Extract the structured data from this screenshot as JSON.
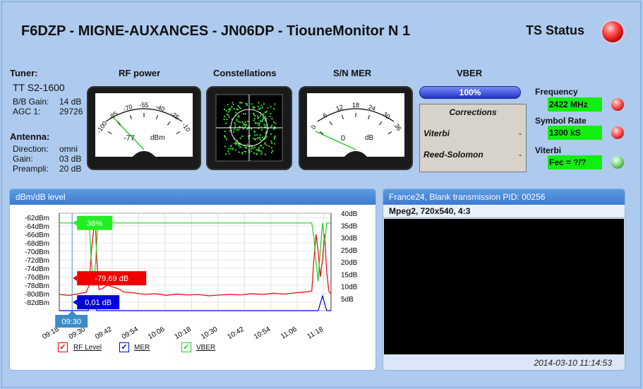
{
  "header": {
    "title": "F6DZP - MIGNE-AUXANCES - JN06DP - TiouneMonitor N 1",
    "ts_status": "TS Status"
  },
  "tuner": {
    "label": "Tuner:",
    "model": "TT S2-1600",
    "bb_gain_label": "B/B Gain:",
    "bb_gain": "14 dB",
    "agc_label": "AGC 1:",
    "agc": "29726"
  },
  "antenna": {
    "label": "Antenna:",
    "direction_label": "Direction:",
    "direction": "omni",
    "gain_label": "Gain:",
    "gain": "03 dB",
    "preampli_label": "Preampli:",
    "preampli": "20 dB"
  },
  "sections": {
    "rf_power": "RF power",
    "constellations": "Constellations",
    "sn_mer": "S/N MER",
    "vber": "VBER"
  },
  "rf_meter": {
    "ticks": [
      "-100",
      "-85",
      "-70",
      "-55",
      "-40",
      "-25",
      "-10"
    ],
    "value": "-77",
    "unit": "dBm",
    "needle_fraction": 0.3
  },
  "mer_meter": {
    "ticks": [
      "0",
      "6",
      "12",
      "18",
      "24",
      "30",
      "36"
    ],
    "value": "0",
    "unit": "dB",
    "needle_fraction": 0.0
  },
  "vber_bar": {
    "label": "100%",
    "fraction": 1.0
  },
  "corrections": {
    "title": "Corrections",
    "viterbi_label": "Viterbi",
    "viterbi": "-",
    "rs_label": "Reed-Solomon",
    "rs": "-"
  },
  "status": {
    "frequency_label": "Frequency",
    "frequency": "2422 MHz",
    "symbol_rate_label": "Symbol Rate",
    "symbol_rate": "1300 kS",
    "viterbi_label": "Viterbi",
    "viterbi": "Fec = ?/?"
  },
  "level_panel": {
    "title": "dBm/dB level"
  },
  "video_panel": {
    "title": "France24, Blank transmission PID: 00256",
    "format": "Mpeg2, 720x540, 4:3",
    "timestamp": "2014-03-10 11:14:53"
  },
  "chart_data": {
    "type": "line",
    "left_axis_ticks": [
      "-62dBm",
      "-64dBm",
      "-66dBm",
      "-68dBm",
      "-70dBm",
      "-72dBm",
      "-74dBm",
      "-76dBm",
      "-78dBm",
      "-80dBm",
      "-82dBm"
    ],
    "right_axis_ticks": [
      "40dB",
      "35dB",
      "30dB",
      "25dB",
      "20dB",
      "15dB",
      "10dB",
      "5dB"
    ],
    "x_ticks": [
      "09:18",
      "09:30",
      "09:42",
      "09:54",
      "10:06",
      "10:18",
      "10:30",
      "10:42",
      "10:54",
      "11:06",
      "11:18"
    ],
    "ylim_left": [
      -84,
      -61
    ],
    "ylim_right": [
      0,
      40
    ],
    "series": [
      {
        "name": "RF Level",
        "color": "#ee0000",
        "y_axis": "left",
        "points": [
          [
            0,
            -80.2
          ],
          [
            10,
            -80.4
          ],
          [
            20,
            -79.9
          ],
          [
            25,
            -79.7
          ],
          [
            28,
            -78
          ],
          [
            30,
            -70
          ],
          [
            32,
            -65
          ],
          [
            34,
            -64.5
          ],
          [
            35,
            -72
          ],
          [
            37,
            -79
          ],
          [
            40,
            -78.8
          ],
          [
            45,
            -78
          ],
          [
            50,
            -78.4
          ],
          [
            55,
            -78.8
          ],
          [
            60,
            -79.6
          ],
          [
            70,
            -79.8
          ],
          [
            80,
            -80.2
          ],
          [
            90,
            -80
          ],
          [
            100,
            -80.4
          ],
          [
            110,
            -80.1
          ],
          [
            120,
            -80.3
          ],
          [
            130,
            -80.2
          ],
          [
            140,
            -80.5
          ],
          [
            150,
            -80.3
          ],
          [
            160,
            -80.2
          ],
          [
            170,
            -80.3
          ],
          [
            180,
            -80
          ],
          [
            190,
            -80.2
          ],
          [
            200,
            -79.9
          ],
          [
            210,
            -80.1
          ],
          [
            220,
            -79.8
          ],
          [
            230,
            -79.6
          ],
          [
            236,
            -79.4
          ],
          [
            238,
            -72
          ],
          [
            240,
            -66
          ],
          [
            242,
            -70
          ],
          [
            244,
            -76
          ],
          [
            246,
            -72
          ],
          [
            248,
            -66
          ],
          [
            250,
            -75
          ],
          [
            252,
            -79.5
          ],
          [
            254,
            -80
          ]
        ]
      },
      {
        "name": "MER",
        "color": "#0000dd",
        "y_axis": "right",
        "points": [
          [
            0,
            0
          ],
          [
            25,
            0
          ],
          [
            27,
            0
          ],
          [
            29,
            3
          ],
          [
            31,
            6
          ],
          [
            33,
            3
          ],
          [
            35,
            0
          ],
          [
            242,
            0
          ],
          [
            244,
            3
          ],
          [
            246,
            6
          ],
          [
            248,
            3
          ],
          [
            250,
            0
          ],
          [
            254,
            0
          ]
        ]
      },
      {
        "name": "VBER",
        "color": "#22cc22",
        "y_axis": "right",
        "points": [
          [
            0,
            36
          ],
          [
            28,
            36
          ],
          [
            30,
            20
          ],
          [
            32,
            10
          ],
          [
            34,
            20
          ],
          [
            36,
            36
          ],
          [
            236,
            36
          ],
          [
            238,
            30
          ],
          [
            240,
            20
          ],
          [
            242,
            12
          ],
          [
            244,
            25
          ],
          [
            246,
            36
          ],
          [
            248,
            28
          ],
          [
            250,
            36
          ],
          [
            254,
            36
          ]
        ]
      }
    ],
    "tooltips": {
      "vber": "36%",
      "rf": "-79,69 dB",
      "mer": "0,01 dB",
      "time": "09:30"
    },
    "cursor_minute": 12,
    "x_start_label": "09:18",
    "legend": [
      "RF Level",
      "MER",
      "VBER"
    ],
    "grid": true
  }
}
